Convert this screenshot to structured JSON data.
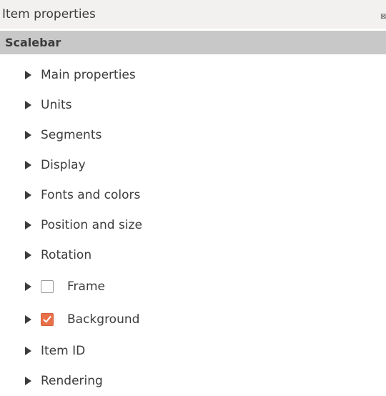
{
  "window": {
    "title": "Item properties",
    "close_glyph": "⊠"
  },
  "header": {
    "label": "Scalebar"
  },
  "sections": [
    {
      "label": "Main properties",
      "icon": "triangle-right"
    },
    {
      "label": "Units",
      "icon": "triangle-right"
    },
    {
      "label": "Segments",
      "icon": "triangle-right"
    },
    {
      "label": "Display",
      "icon": "triangle-right"
    },
    {
      "label": "Fonts and colors",
      "icon": "triangle-right"
    },
    {
      "label": "Position and size",
      "icon": "triangle-right"
    },
    {
      "label": "Rotation",
      "icon": "triangle-right"
    },
    {
      "label": "Frame",
      "icon": "triangle-right",
      "checkbox": false
    },
    {
      "label": "Background",
      "icon": "triangle-right",
      "checkbox": true
    },
    {
      "label": "Item ID",
      "icon": "triangle-right"
    },
    {
      "label": "Rendering",
      "icon": "triangle-right"
    }
  ],
  "colors": {
    "checked": "#e8714a",
    "header_bg": "#c8c8c8",
    "title_bg": "#f2f1f0"
  }
}
